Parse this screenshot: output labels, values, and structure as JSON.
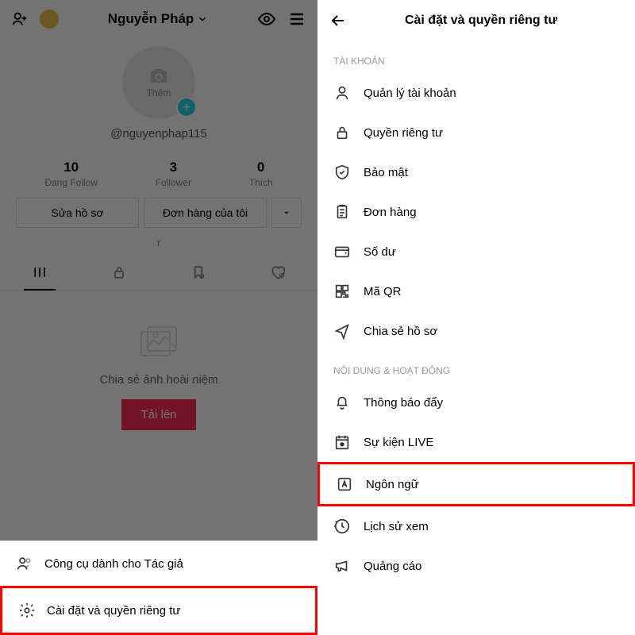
{
  "left": {
    "username": "Nguyễn Pháp",
    "handle": "@nguyenphap115",
    "avatar_label": "Thêm",
    "stats": [
      {
        "num": "10",
        "label": "Đang Follow"
      },
      {
        "num": "3",
        "label": "Follower"
      },
      {
        "num": "0",
        "label": "Thích"
      }
    ],
    "edit_profile": "Sửa hồ sơ",
    "my_orders": "Đơn hàng của tôi",
    "r": "r",
    "empty_text": "Chia sẻ ảnh hoài niệm",
    "upload": "Tải lên",
    "sheet": {
      "creator_tools": "Công cụ dành cho Tác giả",
      "settings": "Cài đặt và quyền riêng tư"
    }
  },
  "right": {
    "title": "Cài đặt và quyền riêng tư",
    "section1": "TÀI KHOẢN",
    "account_items": [
      "Quản lý tài khoản",
      "Quyền riêng tư",
      "Bảo mật",
      "Đơn hàng",
      "Số dư",
      "Mã QR",
      "Chia sẻ hồ sơ"
    ],
    "section2": "NỘI DUNG & HOẠT ĐỘNG",
    "content_items": [
      "Thông báo đẩy",
      "Sự kiện LIVE",
      "Ngôn ngữ",
      "Lịch sử xem",
      "Quảng cáo"
    ]
  }
}
